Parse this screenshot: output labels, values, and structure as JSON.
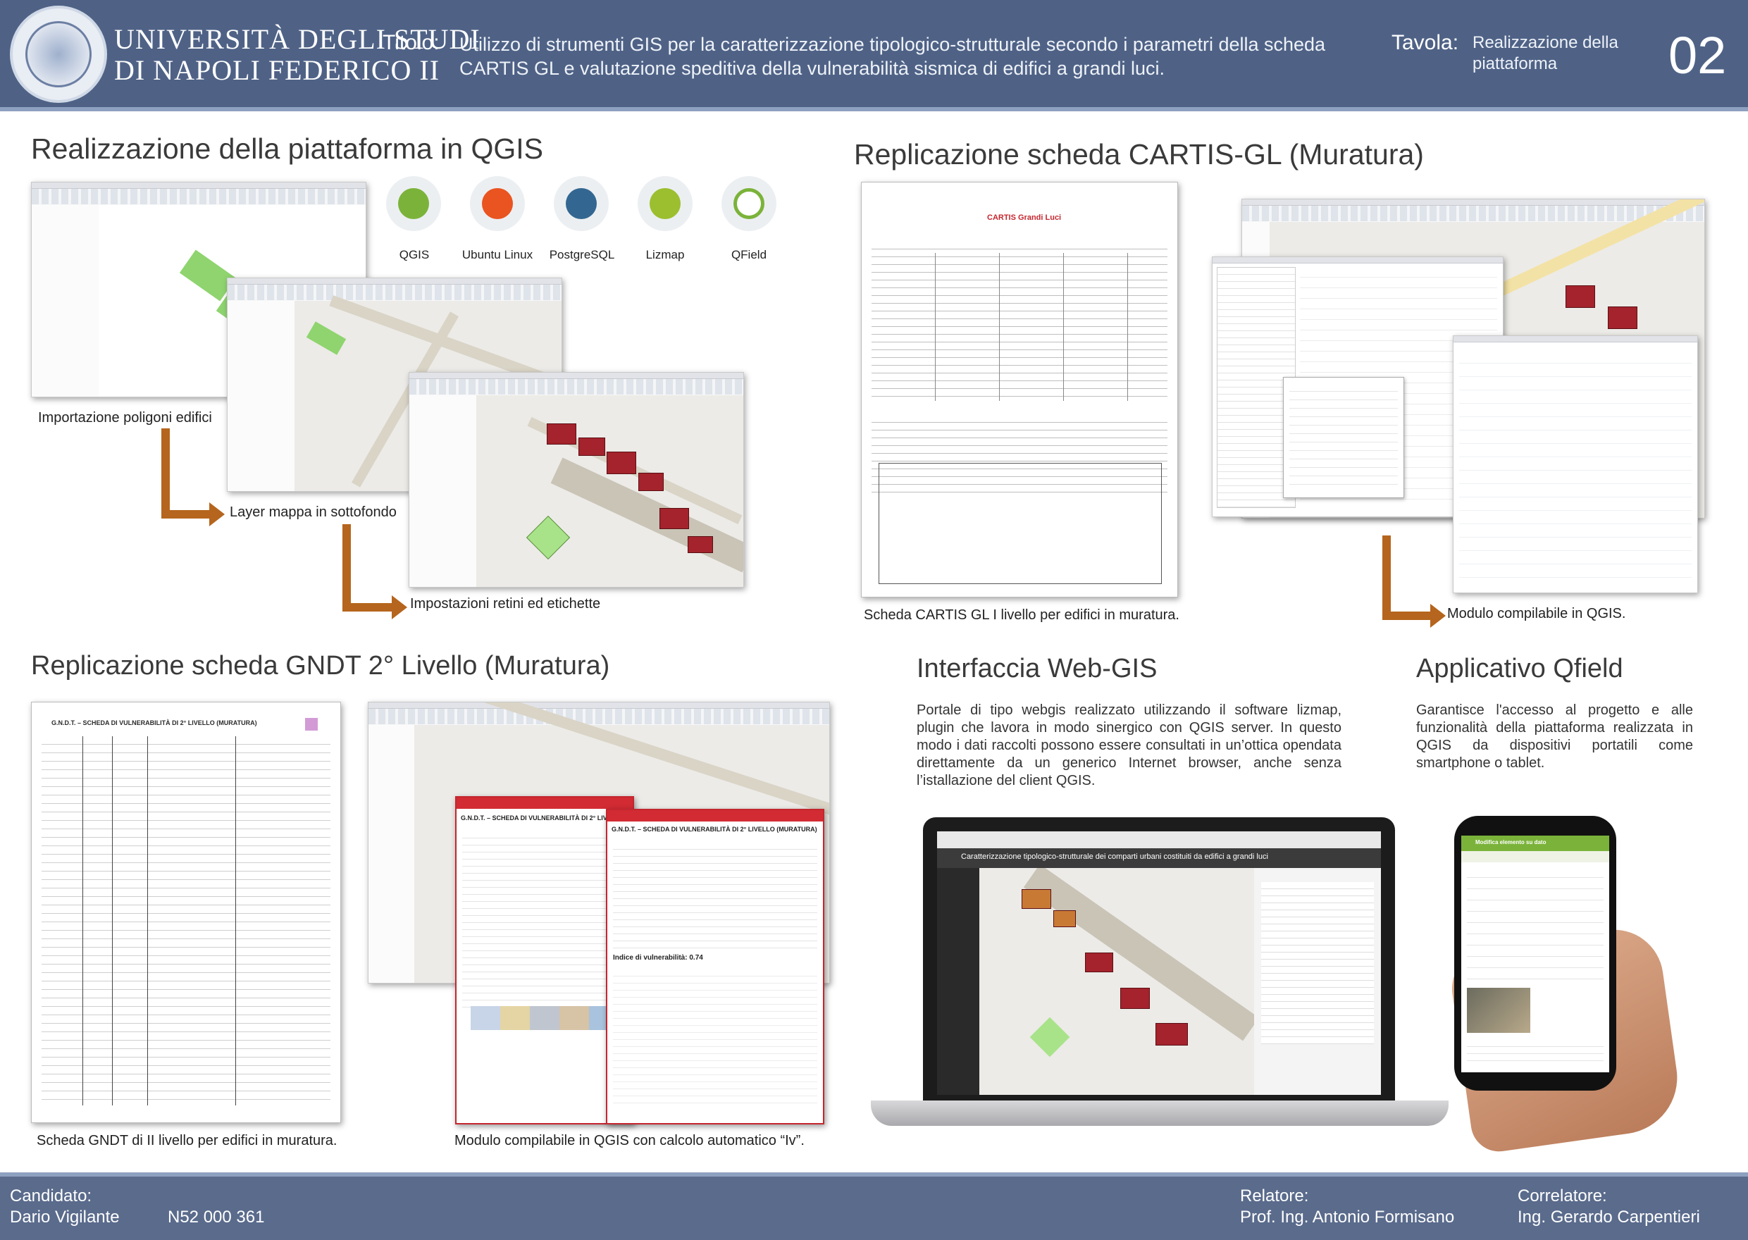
{
  "header": {
    "university_line1": "UNIVERSITÀ DEGLI STUDI",
    "university_line2": "DI NAPOLI FEDERICO II",
    "titolo_label": "Titolo:",
    "titolo_line1": "Utilizzo di strumenti GIS per la caratterizzazione tipologico-strutturale secondo i parametri della scheda",
    "titolo_line2": "CARTIS GL e valutazione speditiva della vulnerabilità sismica di edifici a grandi luci.",
    "tavola_label": "Tavola:",
    "tavola_line1": "Realizzazione della",
    "tavola_line2": "piattaforma",
    "tavola_number": "02"
  },
  "section_qgis": {
    "title": "Realizzazione della piattaforma in QGIS",
    "logos": [
      {
        "label": "QGIS",
        "icon": "qgis-logo-icon",
        "color": "#7bb33a"
      },
      {
        "label": "Ubuntu Linux",
        "icon": "ubuntu-logo-icon",
        "color": "#e95420"
      },
      {
        "label": "PostgreSQL",
        "icon": "postgresql-logo-icon",
        "color": "#336791"
      },
      {
        "label": "Lizmap",
        "icon": "lizmap-logo-icon",
        "color": "#9bbf2e"
      },
      {
        "label": "QField",
        "icon": "qfield-logo-icon",
        "color": "#7bb33a"
      }
    ],
    "step1": "Importazione poligoni edifici",
    "step2": "Layer mappa in sottofondo",
    "step3": "Impostazioni retini ed etichette"
  },
  "section_cartis": {
    "title": "Replicazione scheda CARTIS-GL (Muratura)",
    "form_heading": "CARTIS  Grandi Luci",
    "caption_left": "Scheda CARTIS GL I livello per edifici in muratura.",
    "caption_right": "Modulo compilabile in QGIS."
  },
  "section_gndt": {
    "title": "Replicazione scheda GNDT 2° Livello (Muratura)",
    "form_heading": "G.N.D.T. – SCHEDA DI VULNERABILITÀ DI 2° LIVELLO (MURATURA)",
    "vuln_index": "Indice di vulnerabilità:  0.74",
    "caption_left": "Scheda GNDT di II livello per edifici in muratura.",
    "caption_right": "Modulo compilabile in QGIS con calcolo automatico “Iv”."
  },
  "section_webgis": {
    "title": "Interfaccia Web-GIS",
    "text": "Portale di tipo webgis realizzato utilizzando il software lizmap, plugin che lavora in modo sinergico con QGIS server. In questo modo i dati raccolti possono essere consultati in un’ottica opendata direttamente da un generico Internet browser, anche senza l’istallazione del client QGIS.",
    "screen_title": "Caratterizzazione tipologico-strutturale dei comparti urbani costituiti da edifici a grandi luci"
  },
  "section_qfield": {
    "title": "Applicativo Qfield",
    "text": "Garantisce l'accesso al progetto e alle funzionalità della piattaforma realizzata in QGIS da dispositivi portatili come smartphone o tablet.",
    "phone_header": "Modifica elemento su dato"
  },
  "footer": {
    "candidato_label": "Candidato:",
    "candidato_name": "Dario Vigilante",
    "matricola": "N52 000 361",
    "relatore_label": "Relatore:",
    "relatore_name": "Prof. Ing. Antonio Formisano",
    "correlatore_label": "Correlatore:",
    "correlatore_name": "Ing. Gerardo Carpentieri"
  },
  "colors": {
    "header_bg": "#4f6286",
    "footer_bg": "#5a6b8c",
    "arrow": "#b5651d",
    "building_red": "#a4232c",
    "form_red": "#c4262e"
  }
}
